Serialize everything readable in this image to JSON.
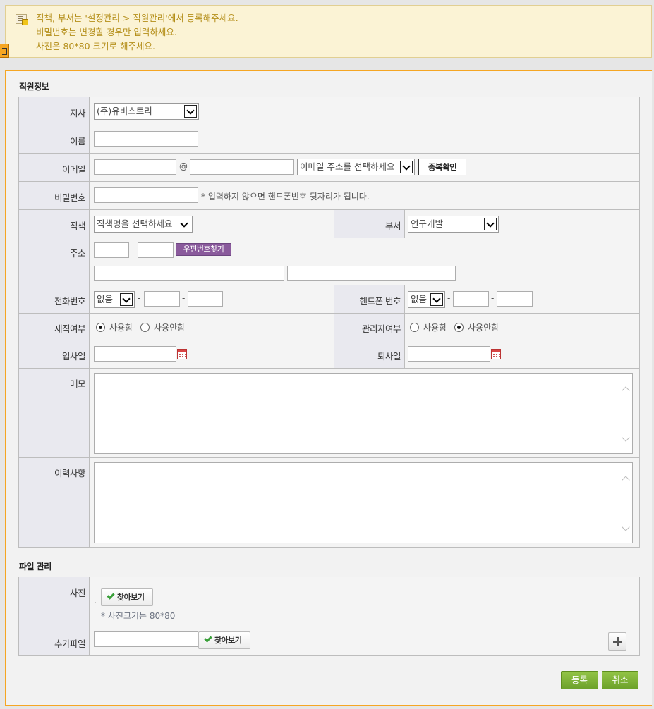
{
  "notice": {
    "lines": [
      "직책, 부서는 '설정관리 > 직원관리'에서 등록해주세요.",
      "비밀번호는 변경할 경우만 입력하세요.",
      "사진은 80*80 크기로 해주세요."
    ]
  },
  "employee_section": {
    "title": "직원정보",
    "branch": {
      "label": "지사",
      "value": "(주)유비스토리"
    },
    "name": {
      "label": "이름",
      "value": ""
    },
    "email": {
      "label": "이메일",
      "at": "@",
      "domain_select": "이메일 주소를 선택하세요",
      "check_button": "중복확인"
    },
    "password": {
      "label": "비밀번호",
      "hint": "* 입력하지 않으면 핸드폰번호 뒷자리가 됩니다."
    },
    "position": {
      "label": "직책",
      "value": "직책명을 선택하세요"
    },
    "department": {
      "label": "부서",
      "value": "연구개발"
    },
    "address": {
      "label": "주소",
      "dash": "-",
      "zip_button": "우편번호찾기"
    },
    "phone": {
      "label": "전화번호",
      "prefix": "없음",
      "dash": "-"
    },
    "mobile": {
      "label": "핸드폰 번호",
      "prefix": "없음",
      "dash": "-"
    },
    "employed": {
      "label": "재직여부",
      "options": [
        "사용함",
        "사용안함"
      ],
      "selected": "사용함"
    },
    "admin": {
      "label": "관리자여부",
      "options": [
        "사용함",
        "사용안함"
      ],
      "selected": "사용안함"
    },
    "join_date": {
      "label": "입사일"
    },
    "leave_date": {
      "label": "퇴사일"
    },
    "memo": {
      "label": "메모"
    },
    "history": {
      "label": "이력사항"
    }
  },
  "file_section": {
    "title": "파일 관리",
    "photo": {
      "label": "사진",
      "dot": ".",
      "browse": "찾아보기",
      "hint": "* 사진크기는 80*80"
    },
    "attachment": {
      "label": "추가파일",
      "browse": "찾아보기"
    }
  },
  "actions": {
    "submit": "등록",
    "cancel": "취소"
  }
}
